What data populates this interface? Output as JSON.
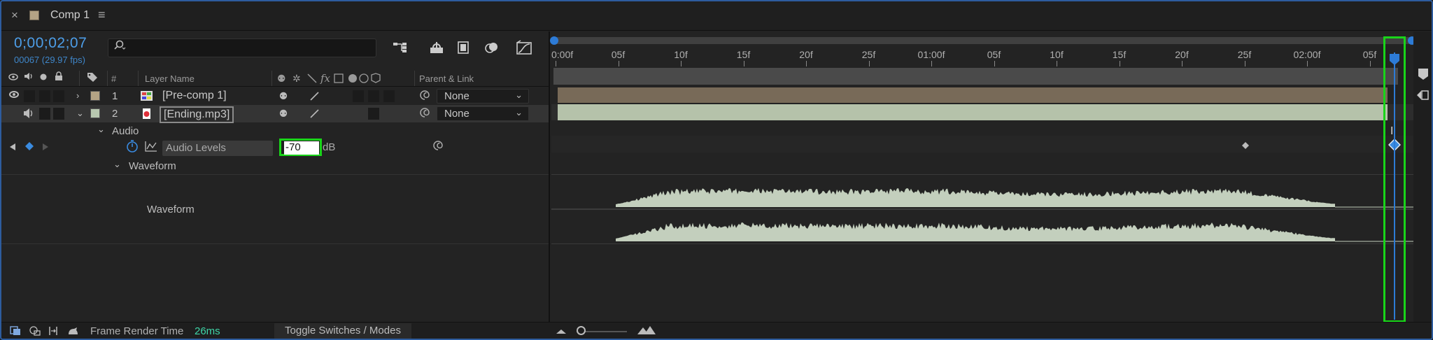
{
  "tab": {
    "close": "×",
    "title": "Comp 1",
    "menu": "≡",
    "swatch_color": "#b4a385"
  },
  "header": {
    "timecode": "0;00;02;07",
    "frames": "00067 (29.97 fps)",
    "search_placeholder": ""
  },
  "columns": {
    "hash": "#",
    "layer_name": "Layer Name",
    "switches": "⚉ ✲ ⟋ fx",
    "parent": "Parent & Link"
  },
  "layers": [
    {
      "number": "1",
      "name": "[Pre-comp 1]",
      "label_color": "#b4a385",
      "parent": "None",
      "type_icon": "composition-icon"
    },
    {
      "number": "2",
      "name": "[Ending.mp3]",
      "label_color": "#b8c8b0",
      "parent": "None",
      "type_icon": "audio-file-icon"
    }
  ],
  "properties": {
    "audio_group": "Audio",
    "audio_levels_label": "Audio Levels",
    "audio_levels_value": "-70",
    "audio_levels_unit": "dB",
    "waveform_group": "Waveform",
    "waveform_label": "Waveform"
  },
  "ruler": {
    "ticks": [
      "0:00f",
      "05f",
      "10f",
      "15f",
      "20f",
      "25f",
      "01:00f",
      "05f",
      "10f",
      "15f",
      "20f",
      "25f",
      "02:00f",
      "05f"
    ]
  },
  "status": {
    "frame_render_label": "Frame Render Time",
    "frame_render_value": "26ms",
    "toggle_label": "Toggle Switches / Modes"
  },
  "colors": {
    "timecode": "#4d9ee8",
    "highlight": "#19d419",
    "precomp_bar": "#786a58",
    "audio_bar": "#b5c2aa",
    "waveform": "#c3cfbd"
  }
}
